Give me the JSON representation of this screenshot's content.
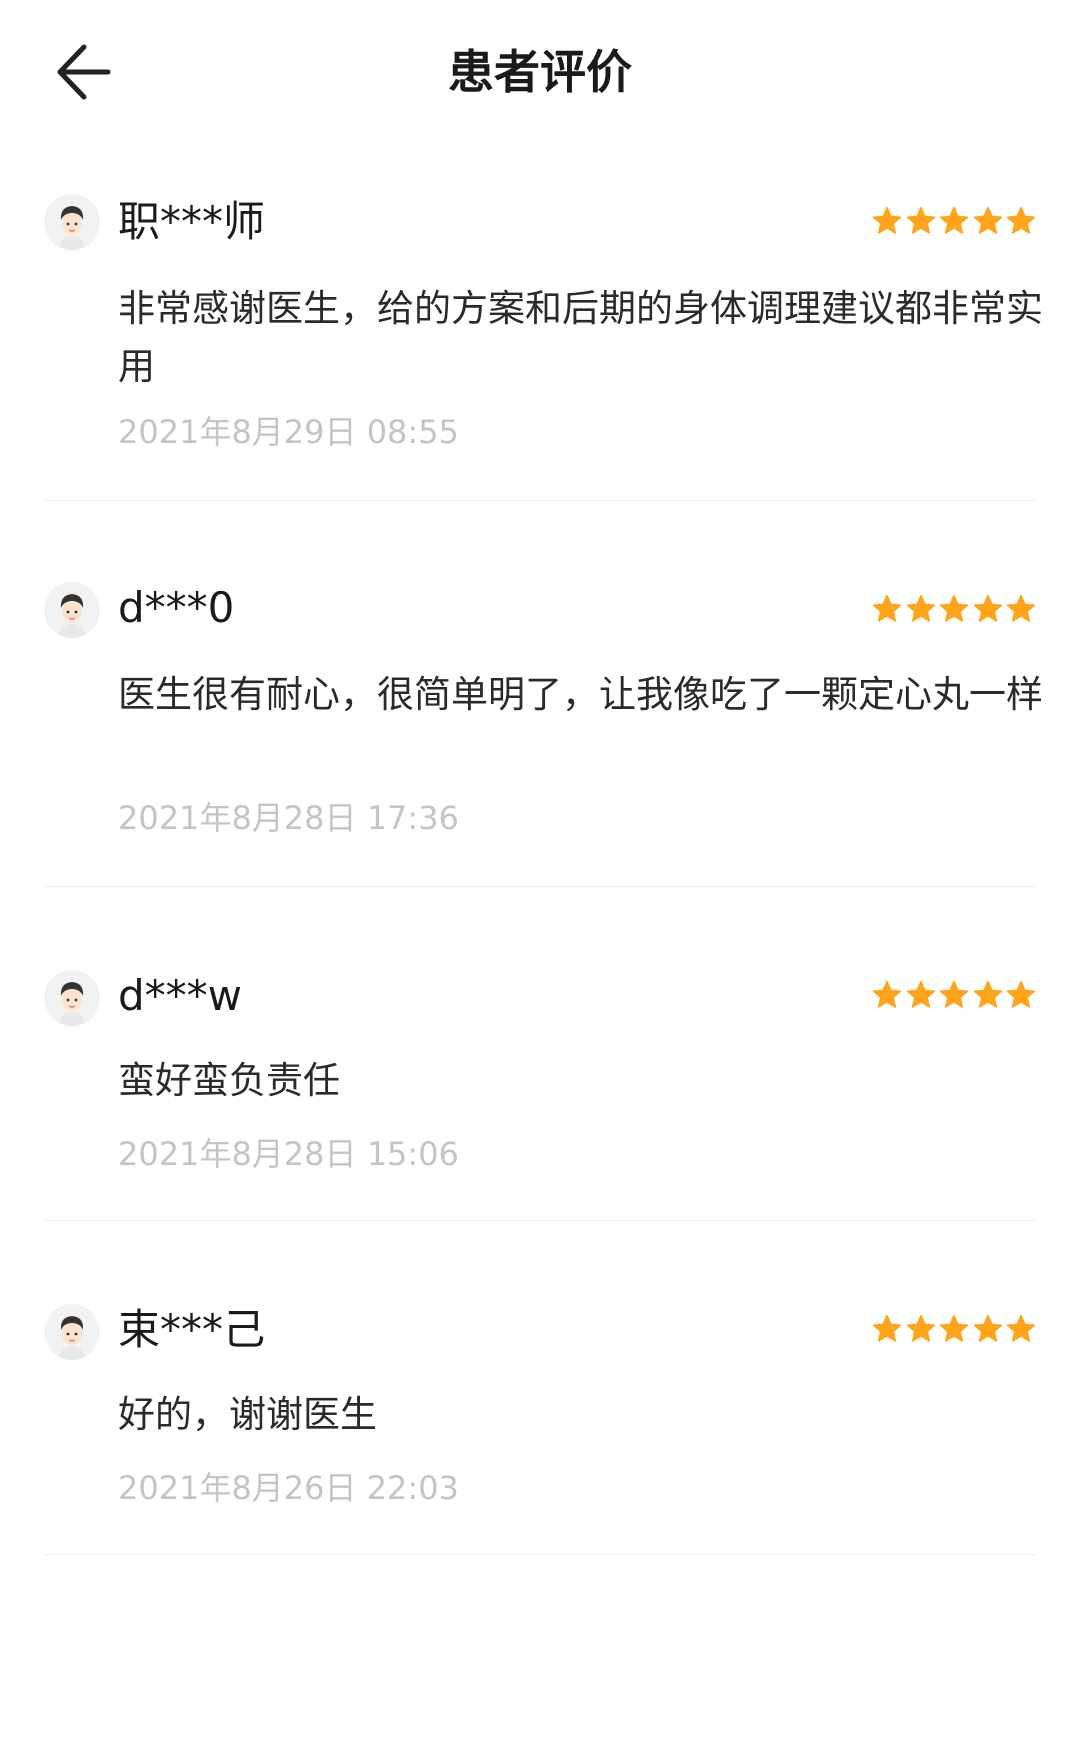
{
  "header": {
    "title": "患者评价",
    "back_icon": "back-arrow-icon"
  },
  "colors": {
    "star": "#FFA41B",
    "date_text": "#C4C4C4",
    "divider": "#EEEEEE"
  },
  "reviews": [
    {
      "user": "职***师",
      "rating": 5,
      "text": "非常感谢医生，给的方案和后期的身体调理建议都非常实用",
      "date": "2021年8月29日 08:55"
    },
    {
      "user": "d***0",
      "rating": 5,
      "text": "医生很有耐心，很简单明了，让我像吃了一颗定心丸一样",
      "date": "2021年8月28日 17:36"
    },
    {
      "user": "d***w",
      "rating": 5,
      "text": "蛮好蛮负责任",
      "date": "2021年8月28日 15:06"
    },
    {
      "user": "束***己",
      "rating": 5,
      "text": "好的，谢谢医生",
      "date": "2021年8月26日 22:03"
    }
  ]
}
